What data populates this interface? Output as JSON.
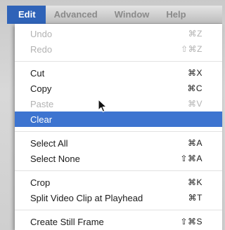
{
  "menubar": {
    "items": [
      "Edit",
      "Advanced",
      "Window",
      "Help"
    ]
  },
  "menu": {
    "undo": {
      "label": "Undo",
      "shortcut": "⌘Z"
    },
    "redo": {
      "label": "Redo",
      "shortcut": "⇧⌘Z"
    },
    "cut": {
      "label": "Cut",
      "shortcut": "⌘X"
    },
    "copy": {
      "label": "Copy",
      "shortcut": "⌘C"
    },
    "paste": {
      "label": "Paste",
      "shortcut": "⌘V"
    },
    "clear": {
      "label": "Clear"
    },
    "select_all": {
      "label": "Select All",
      "shortcut": "⌘A"
    },
    "select_none": {
      "label": "Select None",
      "shortcut": "⇧⌘A"
    },
    "crop": {
      "label": "Crop",
      "shortcut": "⌘K"
    },
    "split": {
      "label": "Split Video Clip at Playhead",
      "shortcut": "⌘T"
    },
    "still_frame": {
      "label": "Create Still Frame",
      "shortcut": "⇧⌘S"
    }
  },
  "colors": {
    "accent": "#3d74d0",
    "menubar_active": "#2f63b8"
  },
  "icons": {
    "cursor": "arrow-cursor-icon"
  }
}
